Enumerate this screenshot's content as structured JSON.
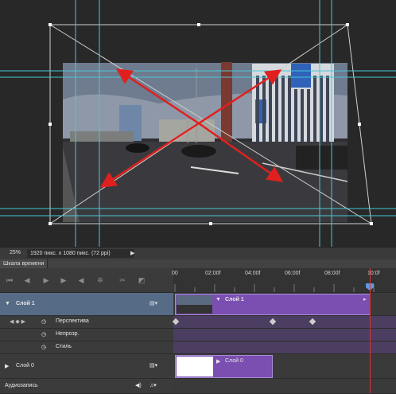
{
  "status": {
    "zoom": "25%",
    "doc_info": "1920 пикс. x 1080 пикс. (72 ppi)",
    "menu_arrow": "▶"
  },
  "timeline": {
    "tab_title": "Шкала времени",
    "ruler": [
      "00",
      "02:00f",
      "04:00f",
      "06:00f",
      "08:00f",
      "10:0f"
    ],
    "layer1": {
      "name": "Слой 1",
      "clip_name": "Слой 1"
    },
    "properties": [
      "Перспектива",
      "Непрозр.",
      "Стиль"
    ],
    "layer0": {
      "name": "Слой 0",
      "clip_name": "Слой 0"
    },
    "audio": {
      "label": "Аудиозапись"
    }
  },
  "icons": {
    "first_frame": "first-frame-icon",
    "prev_frame": "prev-frame-icon",
    "play": "play-icon",
    "next_frame": "next-frame-icon",
    "audio": "speaker-icon",
    "settings": "gear-icon",
    "split": "scissors-icon",
    "transition": "transition-icon",
    "film": "film-icon",
    "music": "music-note-icon"
  },
  "colors": {
    "clip": "#7a4fb1",
    "playhead": "#dd3333",
    "guide": "#49c8d6",
    "arrow": "#e0201e",
    "selected_row": "#566b86"
  }
}
